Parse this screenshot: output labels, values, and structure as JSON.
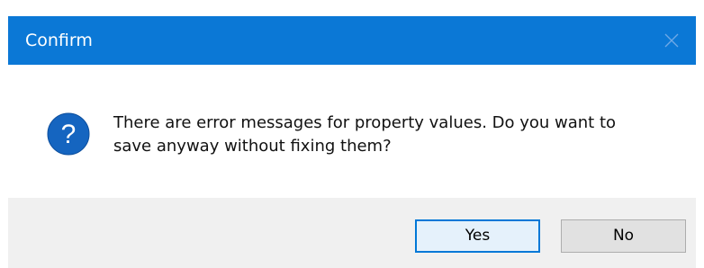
{
  "window": {
    "title": "Confirm",
    "close_icon": "close-icon"
  },
  "message": {
    "icon": "question-icon",
    "line1": "There are error messages for property values. Do you want to",
    "line2": "save anyway without fixing them?"
  },
  "buttons": {
    "yes_label": "Yes",
    "no_label": "No"
  },
  "colors": {
    "titlebar": "#0b78d6",
    "icon": "#1565c0",
    "default_button_border": "#0078d7"
  }
}
